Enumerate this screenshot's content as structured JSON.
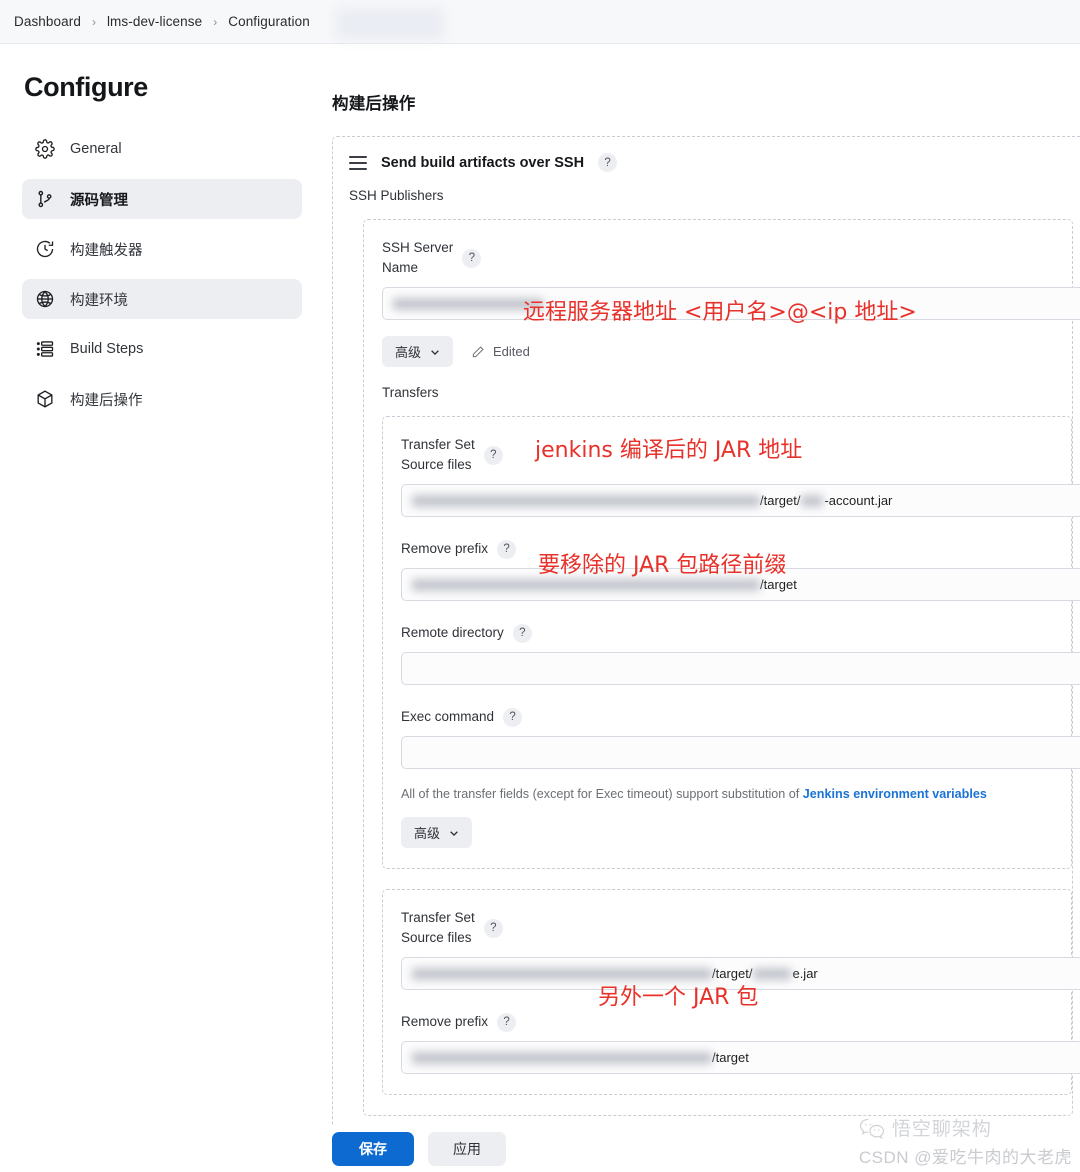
{
  "breadcrumb": {
    "items": [
      "Dashboard",
      "lms-dev-license",
      "Configuration"
    ],
    "separator": "›"
  },
  "sidebar": {
    "title": "Configure",
    "items": [
      {
        "label": "General",
        "icon": "gear-icon",
        "state": "normal"
      },
      {
        "label": "源码管理",
        "icon": "source-branch-icon",
        "state": "active"
      },
      {
        "label": "构建触发器",
        "icon": "clock-icon",
        "state": "normal"
      },
      {
        "label": "构建环境",
        "icon": "globe-icon",
        "state": "hover"
      },
      {
        "label": "Build Steps",
        "icon": "list-steps-icon",
        "state": "normal"
      },
      {
        "label": "构建后操作",
        "icon": "package-icon",
        "state": "normal"
      }
    ]
  },
  "main": {
    "section_title": "构建后操作",
    "plugin": {
      "drag_icon": "drag-handle-icon",
      "title": "Send build artifacts over SSH",
      "help": "?",
      "publishers_label": "SSH Publishers"
    },
    "ssh_server": {
      "label_line1": "SSH Server",
      "label_line2": "Name",
      "help": "?",
      "value": "",
      "advanced_label": "高级",
      "edited_label": "Edited",
      "edit_icon": "pencil-icon",
      "chevron_icon": "chevron-down-icon"
    },
    "transfers_label": "Transfers",
    "transfer_sets": [
      {
        "set_label": "Transfer Set",
        "source_files_label": "Source files",
        "source_files_help": "?",
        "source_files_value_visible": "/target/",
        "source_files_value_tail": "-account.jar",
        "remove_prefix_label": "Remove prefix",
        "remove_prefix_help": "?",
        "remove_prefix_value_visible": "/target",
        "remote_directory_label": "Remote directory",
        "remote_directory_help": "?",
        "remote_directory_value": "",
        "exec_command_label": "Exec command",
        "exec_command_help": "?",
        "exec_command_value": "",
        "helper_prefix": "All of the transfer fields (except for Exec timeout) support substitution of ",
        "helper_link": "Jenkins environment variables",
        "advanced_label": "高级"
      },
      {
        "set_label": "Transfer Set",
        "source_files_label": "Source files",
        "source_files_help": "?",
        "source_files_value_visible": "/target/",
        "source_files_value_tail": "e.jar",
        "remove_prefix_label": "Remove prefix",
        "remove_prefix_help": "?",
        "remove_prefix_value_visible": "/target"
      }
    ]
  },
  "annotations": [
    {
      "id": "annot-server",
      "text": "远程服务器地址 <用户名>@<ip 地址>"
    },
    {
      "id": "annot-jar",
      "text": "jenkins 编译后的 JAR 地址"
    },
    {
      "id": "annot-prefix",
      "text": "要移除的 JAR 包路径前缀"
    },
    {
      "id": "annot-other",
      "text": "另外一个 JAR 包"
    }
  ],
  "action_bar": {
    "save_label": "保存",
    "apply_label": "应用"
  },
  "watermark": {
    "icon": "wechat-icon",
    "account": "悟空聊架构",
    "credit": "CSDN @爱吃牛肉的大老虎"
  },
  "colors": {
    "accent_blue": "#0d6ad1",
    "link_blue": "#1a73d6",
    "annotation_red": "#e8312a",
    "nav_highlight": "#eceef2"
  }
}
